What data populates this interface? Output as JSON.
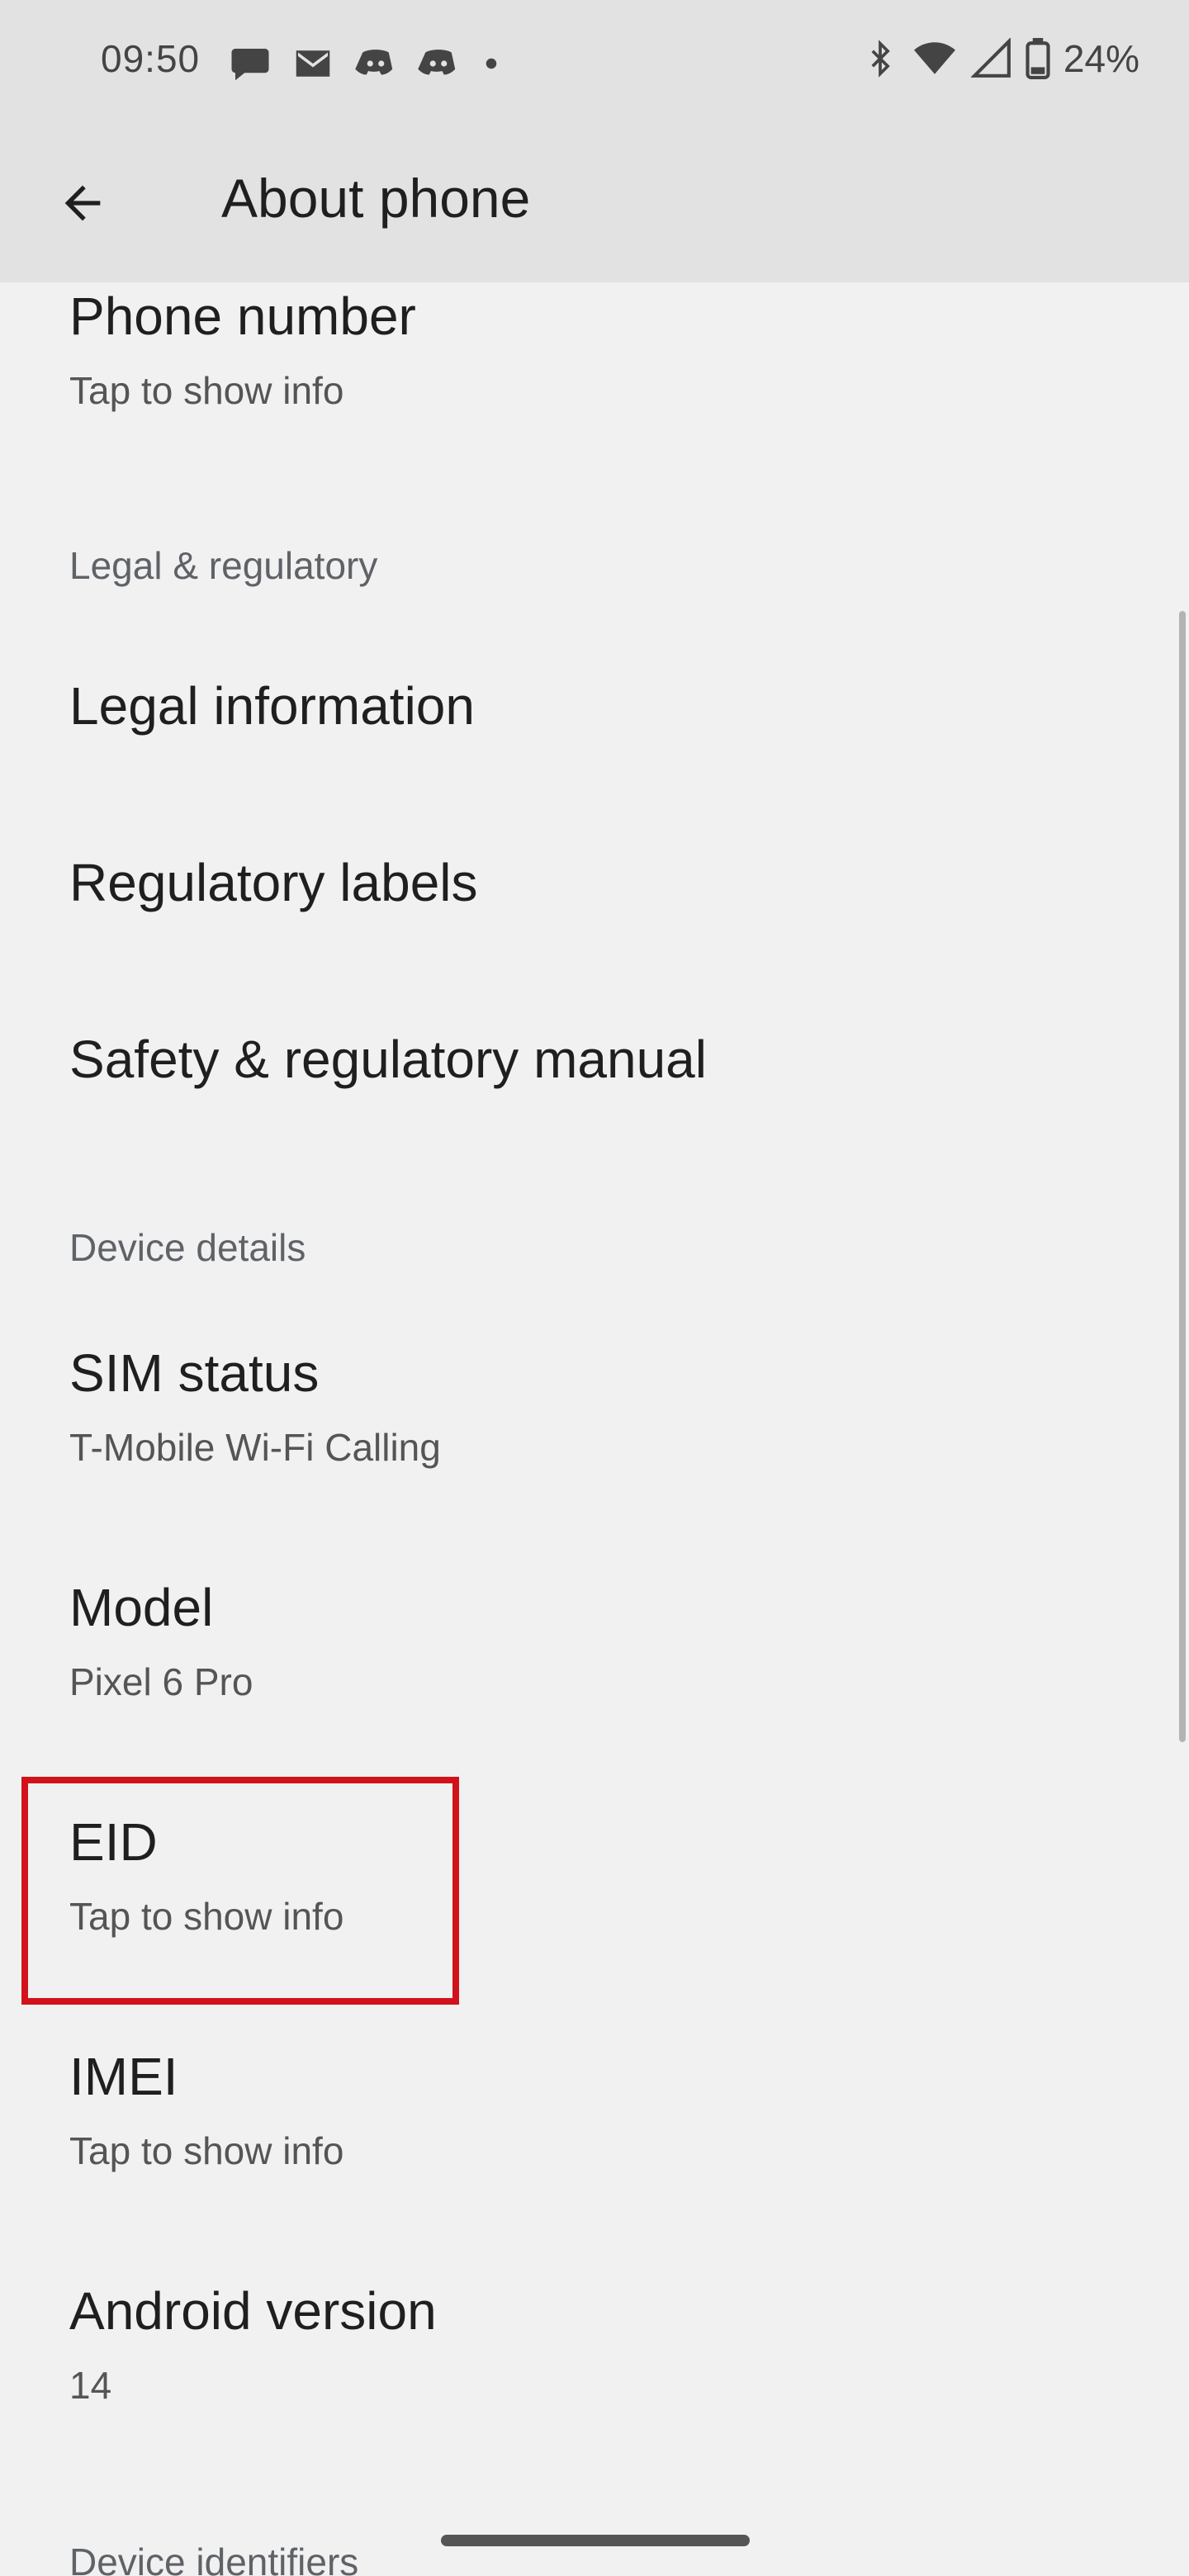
{
  "status": {
    "time": "09:50",
    "battery": "24%",
    "left_icons": [
      "messages-icon",
      "gmail-icon",
      "discord-icon",
      "discord-icon",
      "dot-icon"
    ],
    "right_icons": [
      "bluetooth-icon",
      "wifi-icon",
      "cell-signal-icon",
      "battery-icon"
    ]
  },
  "appbar": {
    "title": "About phone",
    "back_icon": "arrow-back-icon"
  },
  "items": {
    "phone_number": {
      "title": "Phone number",
      "summary": "Tap to show info"
    },
    "legal_header": "Legal & regulatory",
    "legal_information": {
      "title": "Legal information"
    },
    "regulatory_labels": {
      "title": "Regulatory labels"
    },
    "safety_manual": {
      "title": "Safety & regulatory manual"
    },
    "device_details_header": "Device details",
    "sim_status": {
      "title": "SIM status",
      "summary": "T-Mobile Wi-Fi Calling"
    },
    "model": {
      "title": "Model",
      "summary": "Pixel 6 Pro"
    },
    "eid": {
      "title": "EID",
      "summary": "Tap to show info"
    },
    "imei": {
      "title": "IMEI",
      "summary": "Tap to show info"
    },
    "android_version": {
      "title": "Android version",
      "summary": "14"
    },
    "device_identifiers_header": "Device identifiers"
  },
  "colors": {
    "highlight": "#d2121b",
    "topbar": "#e2e2e2",
    "background": "#f1f1f1"
  }
}
